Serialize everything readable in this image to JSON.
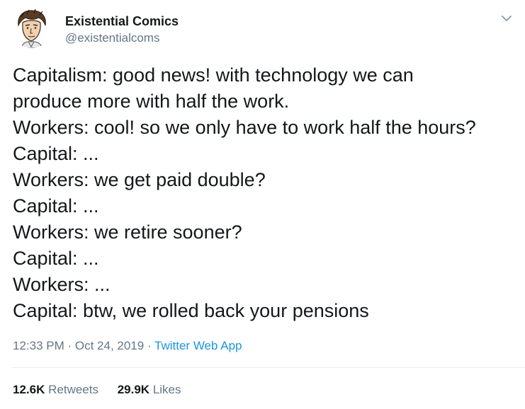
{
  "author": {
    "name": "Existential Comics",
    "handle": "@existentialcoms",
    "avatar_icon": "cartoon-portrait-avatar"
  },
  "menu": {
    "icon": "chevron-down-icon"
  },
  "tweet": {
    "lines": [
      "Capitalism: good news! with technology we can",
      "produce more with half the work.",
      "Workers: cool! so we only have to work half the hours?",
      "Capital: ...",
      "Workers: we get paid double?",
      "Capital: ...",
      "Workers: we retire sooner?",
      "Capital: ...",
      "Workers: ...",
      "Capital: btw, we rolled back your pensions"
    ]
  },
  "meta": {
    "time": "12:33 PM",
    "separator_1": " · ",
    "date": "Oct 24, 2019",
    "separator_2": " · ",
    "source": "Twitter Web App"
  },
  "stats": {
    "retweets_count": "12.6K",
    "retweets_label": "Retweets",
    "likes_count": "29.9K",
    "likes_label": "Likes"
  },
  "colors": {
    "text": "#14171a",
    "secondary": "#657786",
    "link": "#1b95e0",
    "divider": "#e6ecf0"
  }
}
